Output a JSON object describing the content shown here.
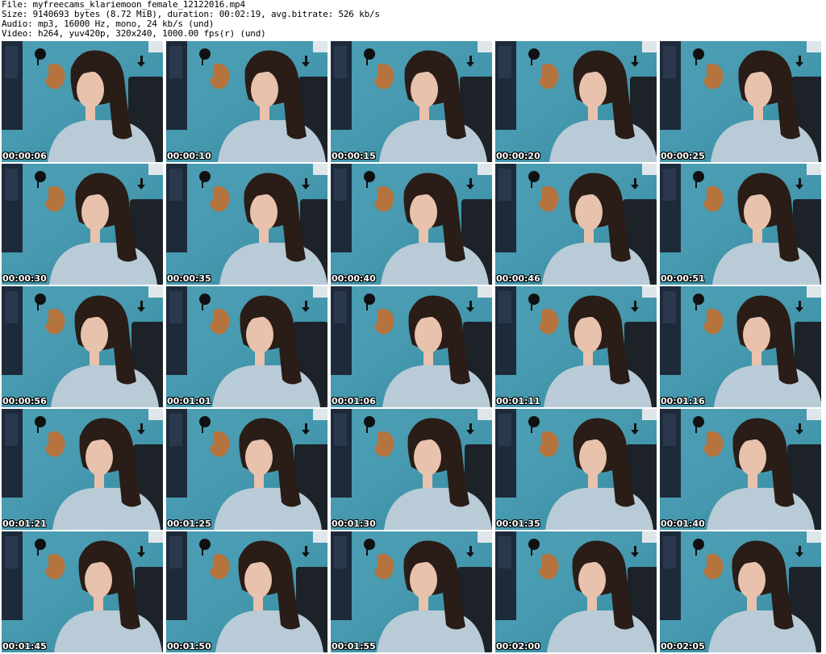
{
  "header": {
    "file_line": "File: myfreecams_klariemoon_female_12122016.mp4",
    "size_line": "Size: 9140693 bytes (8.72 MiB), duration: 00:02:19, avg.bitrate: 526 kb/s",
    "audio_line": "Audio: mp3, 16000 Hz, mono, 24 kb/s (und)",
    "video_line": "Video: h264, yuv420p, 320x240, 1000.00 fps(r) (und)"
  },
  "colors": {
    "wall": "#2f8fa8",
    "wall_dark": "#1e6f85",
    "sweater": "#b9cbd6",
    "hair": "#2a1c16",
    "skin": "#e8c2ac",
    "chair": "#1c2228",
    "poster": "#1d2a3a",
    "bird": "#b5733e",
    "timestamp": "#ffffff"
  },
  "thumbnails": [
    {
      "timestamp": "00:00:06"
    },
    {
      "timestamp": "00:00:10"
    },
    {
      "timestamp": "00:00:15"
    },
    {
      "timestamp": "00:00:20"
    },
    {
      "timestamp": "00:00:25"
    },
    {
      "timestamp": "00:00:30"
    },
    {
      "timestamp": "00:00:35"
    },
    {
      "timestamp": "00:00:40"
    },
    {
      "timestamp": "00:00:46"
    },
    {
      "timestamp": "00:00:51"
    },
    {
      "timestamp": "00:00:56"
    },
    {
      "timestamp": "00:01:01"
    },
    {
      "timestamp": "00:01:06"
    },
    {
      "timestamp": "00:01:11"
    },
    {
      "timestamp": "00:01:16"
    },
    {
      "timestamp": "00:01:21"
    },
    {
      "timestamp": "00:01:25"
    },
    {
      "timestamp": "00:01:30"
    },
    {
      "timestamp": "00:01:35"
    },
    {
      "timestamp": "00:01:40"
    },
    {
      "timestamp": "00:01:45"
    },
    {
      "timestamp": "00:01:50"
    },
    {
      "timestamp": "00:01:55"
    },
    {
      "timestamp": "00:02:00"
    },
    {
      "timestamp": "00:02:05"
    }
  ]
}
